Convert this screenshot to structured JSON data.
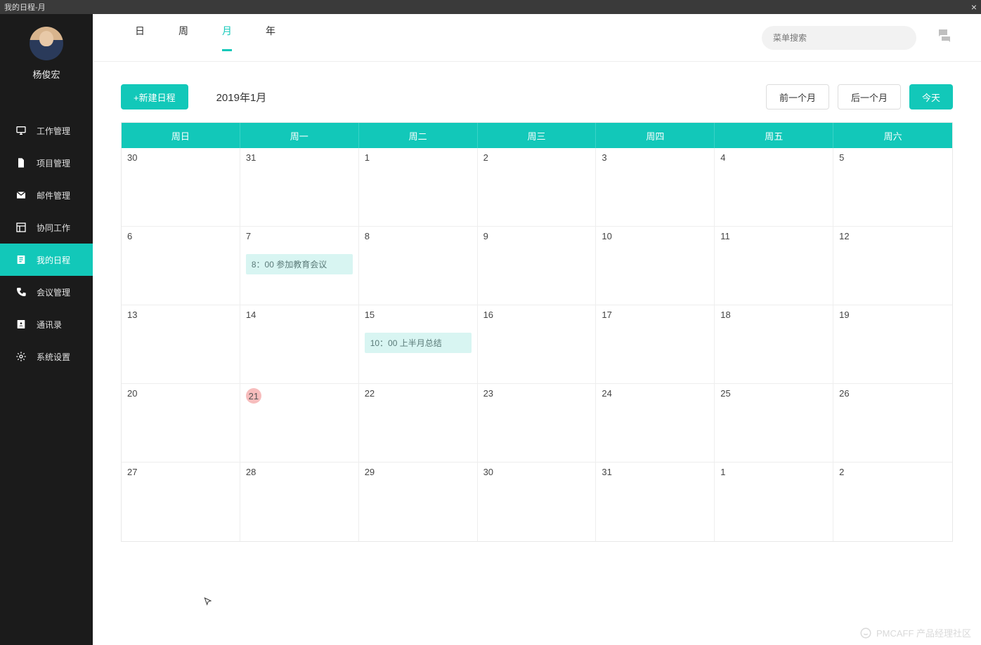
{
  "window": {
    "title": "我的日程-月"
  },
  "user": {
    "name": "杨俊宏"
  },
  "sidebar": {
    "items": [
      {
        "label": "工作管理",
        "icon": "monitor-icon"
      },
      {
        "label": "项目管理",
        "icon": "file-icon"
      },
      {
        "label": "邮件管理",
        "icon": "mail-icon"
      },
      {
        "label": "协同工作",
        "icon": "layout-icon"
      },
      {
        "label": "我的日程",
        "icon": "note-icon",
        "active": true
      },
      {
        "label": "会议管理",
        "icon": "phone-icon"
      },
      {
        "label": "通讯录",
        "icon": "contacts-icon"
      },
      {
        "label": "系统设置",
        "icon": "gear-icon"
      }
    ]
  },
  "view_tabs": {
    "items": [
      {
        "label": "日"
      },
      {
        "label": "周"
      },
      {
        "label": "月",
        "active": true
      },
      {
        "label": "年"
      }
    ]
  },
  "search": {
    "placeholder": "菜单搜索"
  },
  "toolbar": {
    "new_label": "+新建日程",
    "month_label": "2019年1月",
    "prev_label": "前一个月",
    "next_label": "后一个月",
    "today_label": "今天"
  },
  "calendar": {
    "weekdays": [
      "周日",
      "周一",
      "周二",
      "周三",
      "周四",
      "周五",
      "周六"
    ],
    "weeks": [
      [
        {
          "d": "30",
          "dim": true
        },
        {
          "d": "31",
          "dim": true
        },
        {
          "d": "1"
        },
        {
          "d": "2"
        },
        {
          "d": "3"
        },
        {
          "d": "4"
        },
        {
          "d": "5"
        }
      ],
      [
        {
          "d": "6"
        },
        {
          "d": "7",
          "event": "8：00 参加教育会议"
        },
        {
          "d": "8"
        },
        {
          "d": "9"
        },
        {
          "d": "10"
        },
        {
          "d": "11"
        },
        {
          "d": "12"
        }
      ],
      [
        {
          "d": "13"
        },
        {
          "d": "14"
        },
        {
          "d": "15",
          "event": "10：00 上半月总结"
        },
        {
          "d": "16"
        },
        {
          "d": "17"
        },
        {
          "d": "18"
        },
        {
          "d": "19"
        }
      ],
      [
        {
          "d": "20"
        },
        {
          "d": "21",
          "today": true
        },
        {
          "d": "22"
        },
        {
          "d": "23"
        },
        {
          "d": "24"
        },
        {
          "d": "25"
        },
        {
          "d": "26"
        }
      ],
      [
        {
          "d": "27"
        },
        {
          "d": "28"
        },
        {
          "d": "29"
        },
        {
          "d": "30"
        },
        {
          "d": "31"
        },
        {
          "d": "1",
          "dim": true
        },
        {
          "d": "2",
          "dim": true
        }
      ]
    ]
  },
  "watermark": {
    "text": "PMCAFF 产品经理社区"
  }
}
